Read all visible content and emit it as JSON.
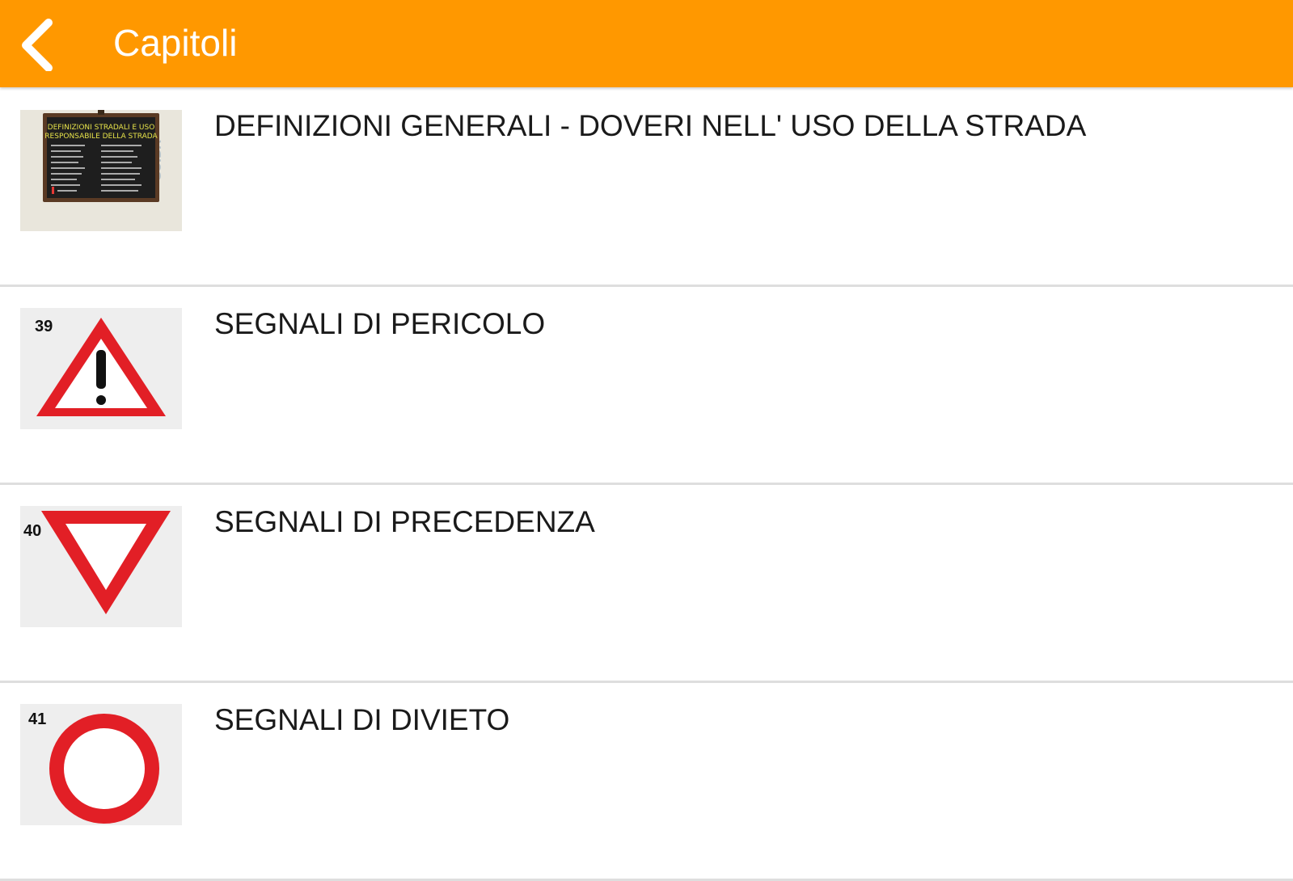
{
  "header": {
    "title": "Capitoli",
    "back_icon": "chevron-left-icon",
    "background_color": "#ff9800"
  },
  "chapters": [
    {
      "label": "DEFINIZIONI GENERALI - DOVERI NELL' USO DELLA STRADA",
      "thumbnail": "chalkboard-image",
      "board_title": "DEFINIZIONI STRADALI E USO RESPONSABILE DELLA STRADA",
      "side_text": "GUIDA"
    },
    {
      "label": "SEGNALI DI PERICOLO",
      "thumbnail": "warning-triangle-sign",
      "sign_number": "39"
    },
    {
      "label": "SEGNALI DI PRECEDENZA",
      "thumbnail": "yield-triangle-sign",
      "sign_number": "40"
    },
    {
      "label": "SEGNALI DI DIVIETO",
      "thumbnail": "prohibition-circle-sign",
      "sign_number": "41"
    }
  ]
}
